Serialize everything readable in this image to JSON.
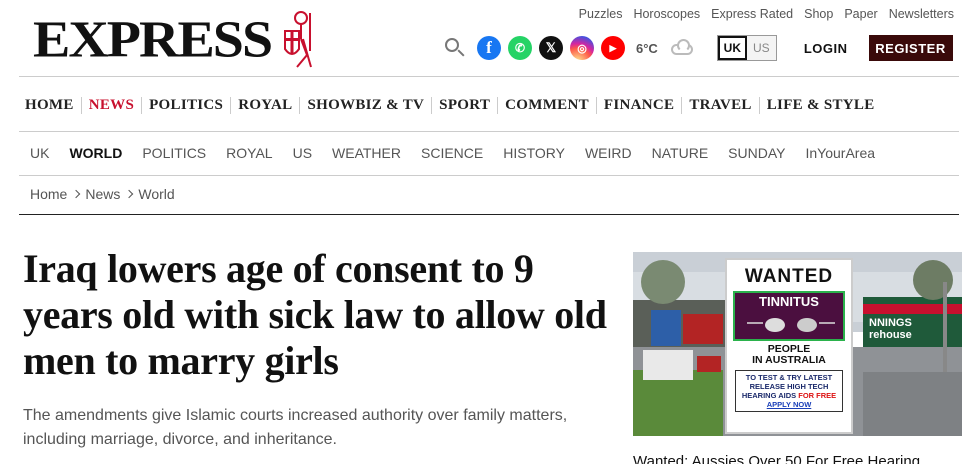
{
  "brand": {
    "logo_text": "EXPRESS"
  },
  "top_links": [
    "Puzzles",
    "Horoscopes",
    "Express Rated",
    "Shop",
    "Paper",
    "Newsletters"
  ],
  "utility": {
    "social": [
      {
        "name": "facebook-icon",
        "glyph": "f"
      },
      {
        "name": "whatsapp-icon",
        "glyph": "✆"
      },
      {
        "name": "x-icon",
        "glyph": "𝕏"
      },
      {
        "name": "instagram-icon",
        "glyph": "◎"
      },
      {
        "name": "youtube-icon",
        "glyph": "▶"
      }
    ],
    "temperature": "6°C",
    "weather_icon": "cloud-icon",
    "editions": [
      "UK",
      "US"
    ],
    "active_edition": "UK",
    "login_label": "LOGIN",
    "register_label": "REGISTER"
  },
  "main_nav": {
    "items": [
      "HOME",
      "NEWS",
      "POLITICS",
      "ROYAL",
      "SHOWBIZ & TV",
      "SPORT",
      "COMMENT",
      "FINANCE",
      "TRAVEL",
      "LIFE & STYLE"
    ],
    "active": "NEWS"
  },
  "sub_nav": {
    "items": [
      "UK",
      "WORLD",
      "POLITICS",
      "ROYAL",
      "US",
      "WEATHER",
      "SCIENCE",
      "HISTORY",
      "WEIRD",
      "NATURE",
      "SUNDAY",
      "InYourArea"
    ],
    "active": "WORLD"
  },
  "breadcrumb": [
    "Home",
    "News",
    "World"
  ],
  "article": {
    "headline": "Iraq lowers age of consent to 9 years old with sick law to allow old men to marry girls",
    "standfirst": "The amendments give Islamic courts increased authority over family matters, including marriage, divorce, and inheritance."
  },
  "ad": {
    "store_sign": "NNINGS\nrehouse",
    "poster": {
      "wanted": "WANTED",
      "tinnitus": "TINNITUS",
      "people_line1": "PEOPLE",
      "people_line2": "IN AUSTRALIA",
      "fine_text": "TO TEST & TRY LATEST RELEASE HIGH TECH HEARING AIDS",
      "free_text": "FOR FREE",
      "apply_text": "APPLY NOW"
    },
    "caption": "Wanted: Aussies Over 50 For Free Hearing"
  }
}
